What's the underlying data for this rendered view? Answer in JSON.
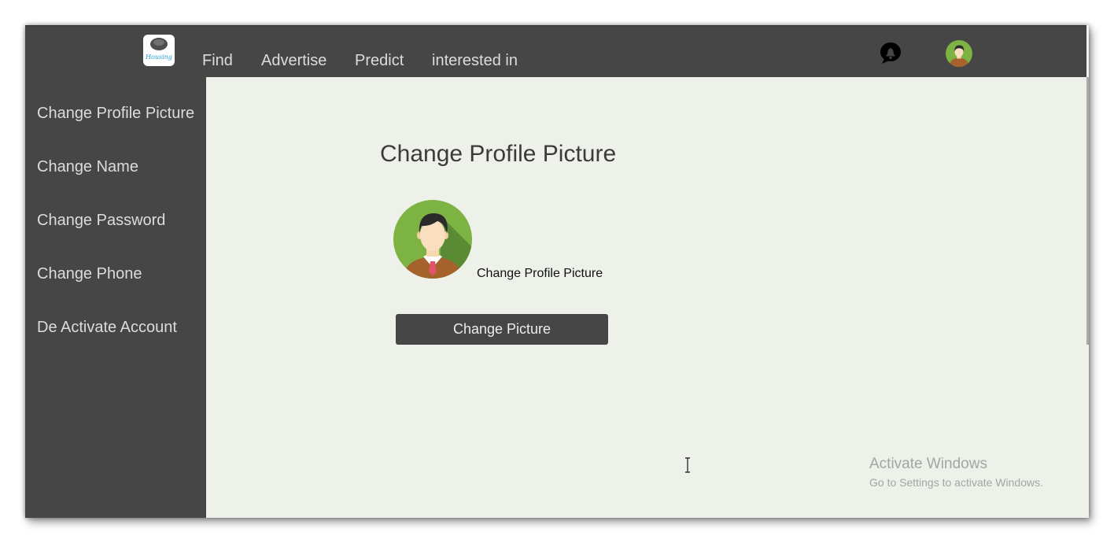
{
  "brand": {
    "logo_text": "Housing"
  },
  "nav": {
    "links": [
      {
        "label": "Find"
      },
      {
        "label": "Advertise"
      },
      {
        "label": "Predict"
      },
      {
        "label": "interested in"
      }
    ]
  },
  "header_icons": {
    "notifications": "bell-icon",
    "profile": "user-avatar"
  },
  "sidebar": {
    "items": [
      {
        "label": "Change Profile Picture"
      },
      {
        "label": "Change Name"
      },
      {
        "label": "Change Password"
      },
      {
        "label": "Change Phone"
      },
      {
        "label": "De Activate Account"
      }
    ]
  },
  "main": {
    "title": "Change Profile Picture",
    "picture_label": "Change Profile Picture",
    "button_label": "Change Picture"
  },
  "watermark": {
    "title": "Activate Windows",
    "subtitle": "Go to Settings to activate Windows."
  },
  "colors": {
    "topbar": "#464646",
    "sidebar": "#464646",
    "content_bg": "#edf1e9",
    "nav_text": "#dcdcdc",
    "avatar_green": "#7cb342"
  }
}
